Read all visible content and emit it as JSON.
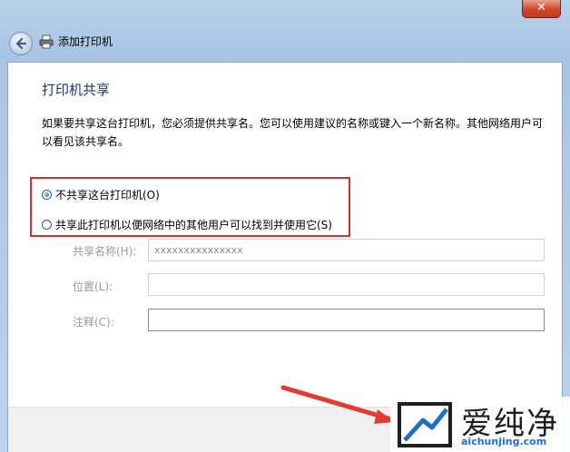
{
  "window": {
    "title": "添加打印机",
    "close_label": "✕"
  },
  "page": {
    "heading": "打印机共享",
    "description": "如果要共享这台打印机，您必须提供共享名。您可以使用建议的名称或键入一个新名称。其他网络用户可以看见该共享名。"
  },
  "sharing_options": [
    {
      "label": "不共享这台打印机(O)",
      "selected": true
    },
    {
      "label": "共享此打印机以便网络中的其他用户可以找到并使用它(S)",
      "selected": false
    }
  ],
  "fields": {
    "share_name": {
      "label": "共享名称(H):",
      "value": "xxxxxxxxxxxxxxx"
    },
    "location": {
      "label": "位置(L):",
      "value": ""
    },
    "comment": {
      "label": "注释(C):",
      "value": ""
    }
  },
  "watermark": {
    "name": "爱纯净",
    "url": "aichunjing.com"
  },
  "colors": {
    "highlight_border": "#d8312b",
    "heading": "#1e3287",
    "watermark_url": "#1f6fc6"
  }
}
